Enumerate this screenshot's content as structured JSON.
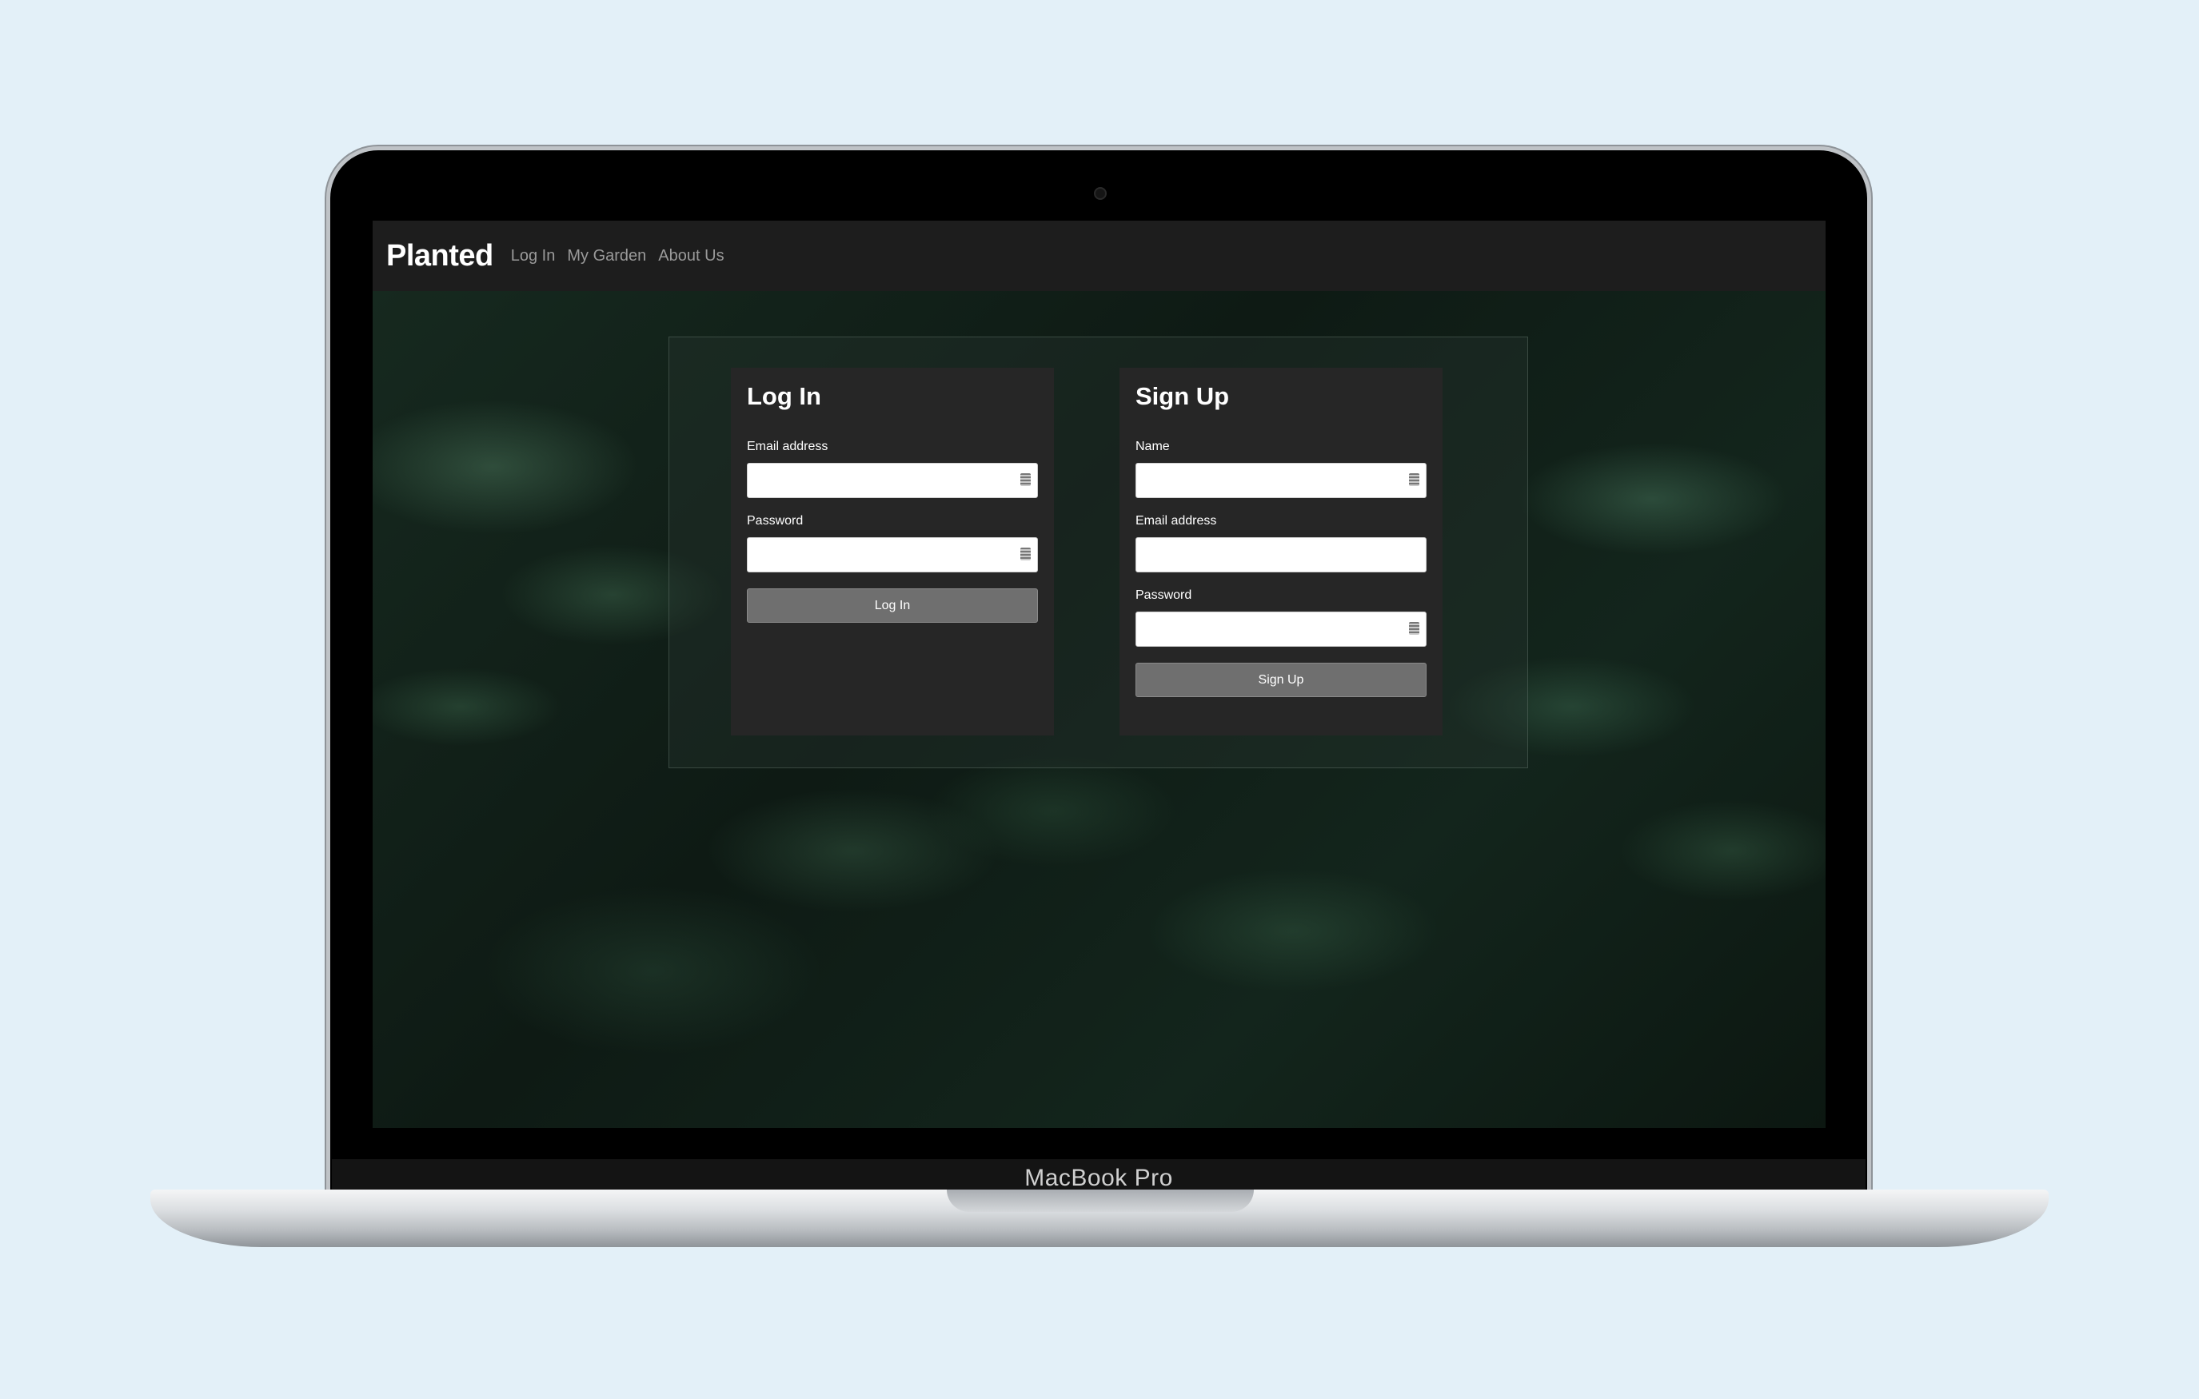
{
  "device": {
    "label": "MacBook Pro"
  },
  "navbar": {
    "brand": "Planted",
    "links": [
      "Log In",
      "My Garden",
      "About Us"
    ]
  },
  "login": {
    "title": "Log In",
    "email_label": "Email address",
    "email_value": "",
    "password_label": "Password",
    "password_value": "",
    "button": "Log In"
  },
  "signup": {
    "title": "Sign Up",
    "name_label": "Name",
    "name_value": "",
    "email_label": "Email address",
    "email_value": "",
    "password_label": "Password",
    "password_value": "",
    "button": "Sign Up"
  },
  "icons": {
    "field_autofill": "password-manager-key-icon",
    "camera": "webcam-icon"
  },
  "colors": {
    "page_background": "#e3f0f8",
    "navbar": "#1d1d1d",
    "card": "#262626",
    "button": "#6f6f6f"
  }
}
